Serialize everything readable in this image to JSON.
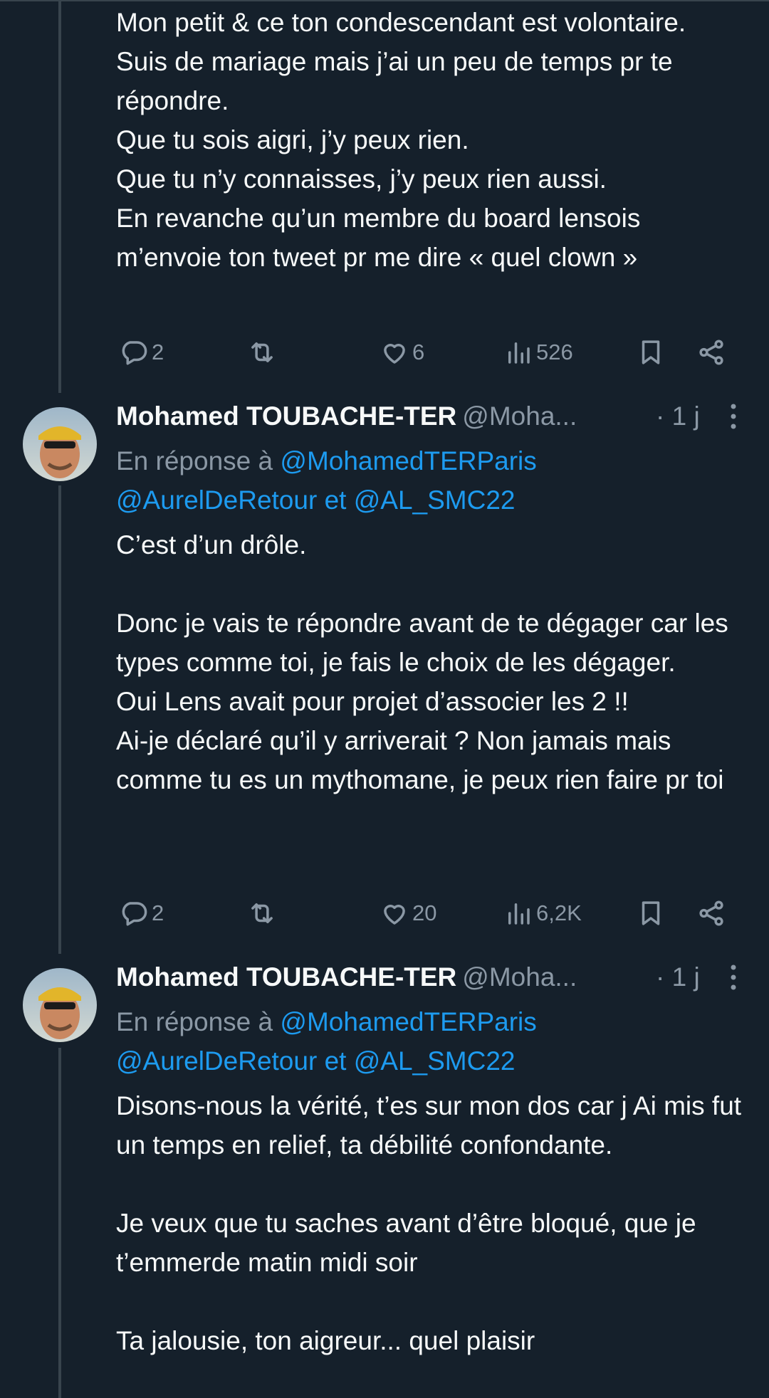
{
  "thread": [
    {
      "text": "Mon petit & ce ton condescendant est volontaire.\nSuis de mariage mais j’ai un peu de temps pr te répondre.\nQue tu sois aigri, j’y peux rien.\nQue tu n’y connaisses, j’y peux rien aussi.\nEn revanche qu’un membre du board lensois m’envoie ton tweet pr me dire « quel clown »",
      "actions": {
        "replies": "2",
        "reposts": "",
        "likes": "6",
        "views": "526"
      }
    },
    {
      "author": {
        "name": "Mohamed TOUBACHE-TER",
        "handle": "@Moha..."
      },
      "time": "· 1 j",
      "reply_to": {
        "prefix": "En réponse à",
        "mention1": "@MohamedTERParis",
        "mention2": "@AurelDeRetour",
        "joiner": "et",
        "mention3": "@AL_SMC22"
      },
      "text": "C’est d’un drôle.\n\nDonc je vais te répondre avant de te dégager car les types comme toi, je fais le choix de les dégager.\nOui Lens avait pour projet d’associer les 2 !!\nAi-je déclaré qu’il y arriverait ? Non jamais mais comme tu es un mythomane, je peux rien faire pr toi",
      "actions": {
        "replies": "2",
        "reposts": "",
        "likes": "20",
        "views": "6,2K"
      }
    },
    {
      "author": {
        "name": "Mohamed TOUBACHE-TER",
        "handle": "@Moha..."
      },
      "time": "· 1 j",
      "reply_to": {
        "prefix": "En réponse à",
        "mention1": "@MohamedTERParis",
        "mention2": "@AurelDeRetour",
        "joiner": "et",
        "mention3": "@AL_SMC22"
      },
      "text": "Disons-nous la vérité, t’es sur mon dos car j Ai mis fut un temps en relief, ta débilité confondante.\n\nJe veux que tu saches avant d’être bloqué, que je t’emmerde matin midi soir\n\nTa jalousie, ton aigreur... quel plaisir"
    }
  ],
  "icons": {
    "reply": "reply-icon",
    "repost": "repost-icon",
    "like": "like-icon",
    "views": "views-icon",
    "bookmark": "bookmark-icon",
    "share": "share-icon",
    "more": "more-icon"
  },
  "colors": {
    "background": "#15202b",
    "text": "#f7f9f9",
    "secondary": "#8b98a5",
    "link": "#1d9bf0",
    "line": "#38444d"
  }
}
